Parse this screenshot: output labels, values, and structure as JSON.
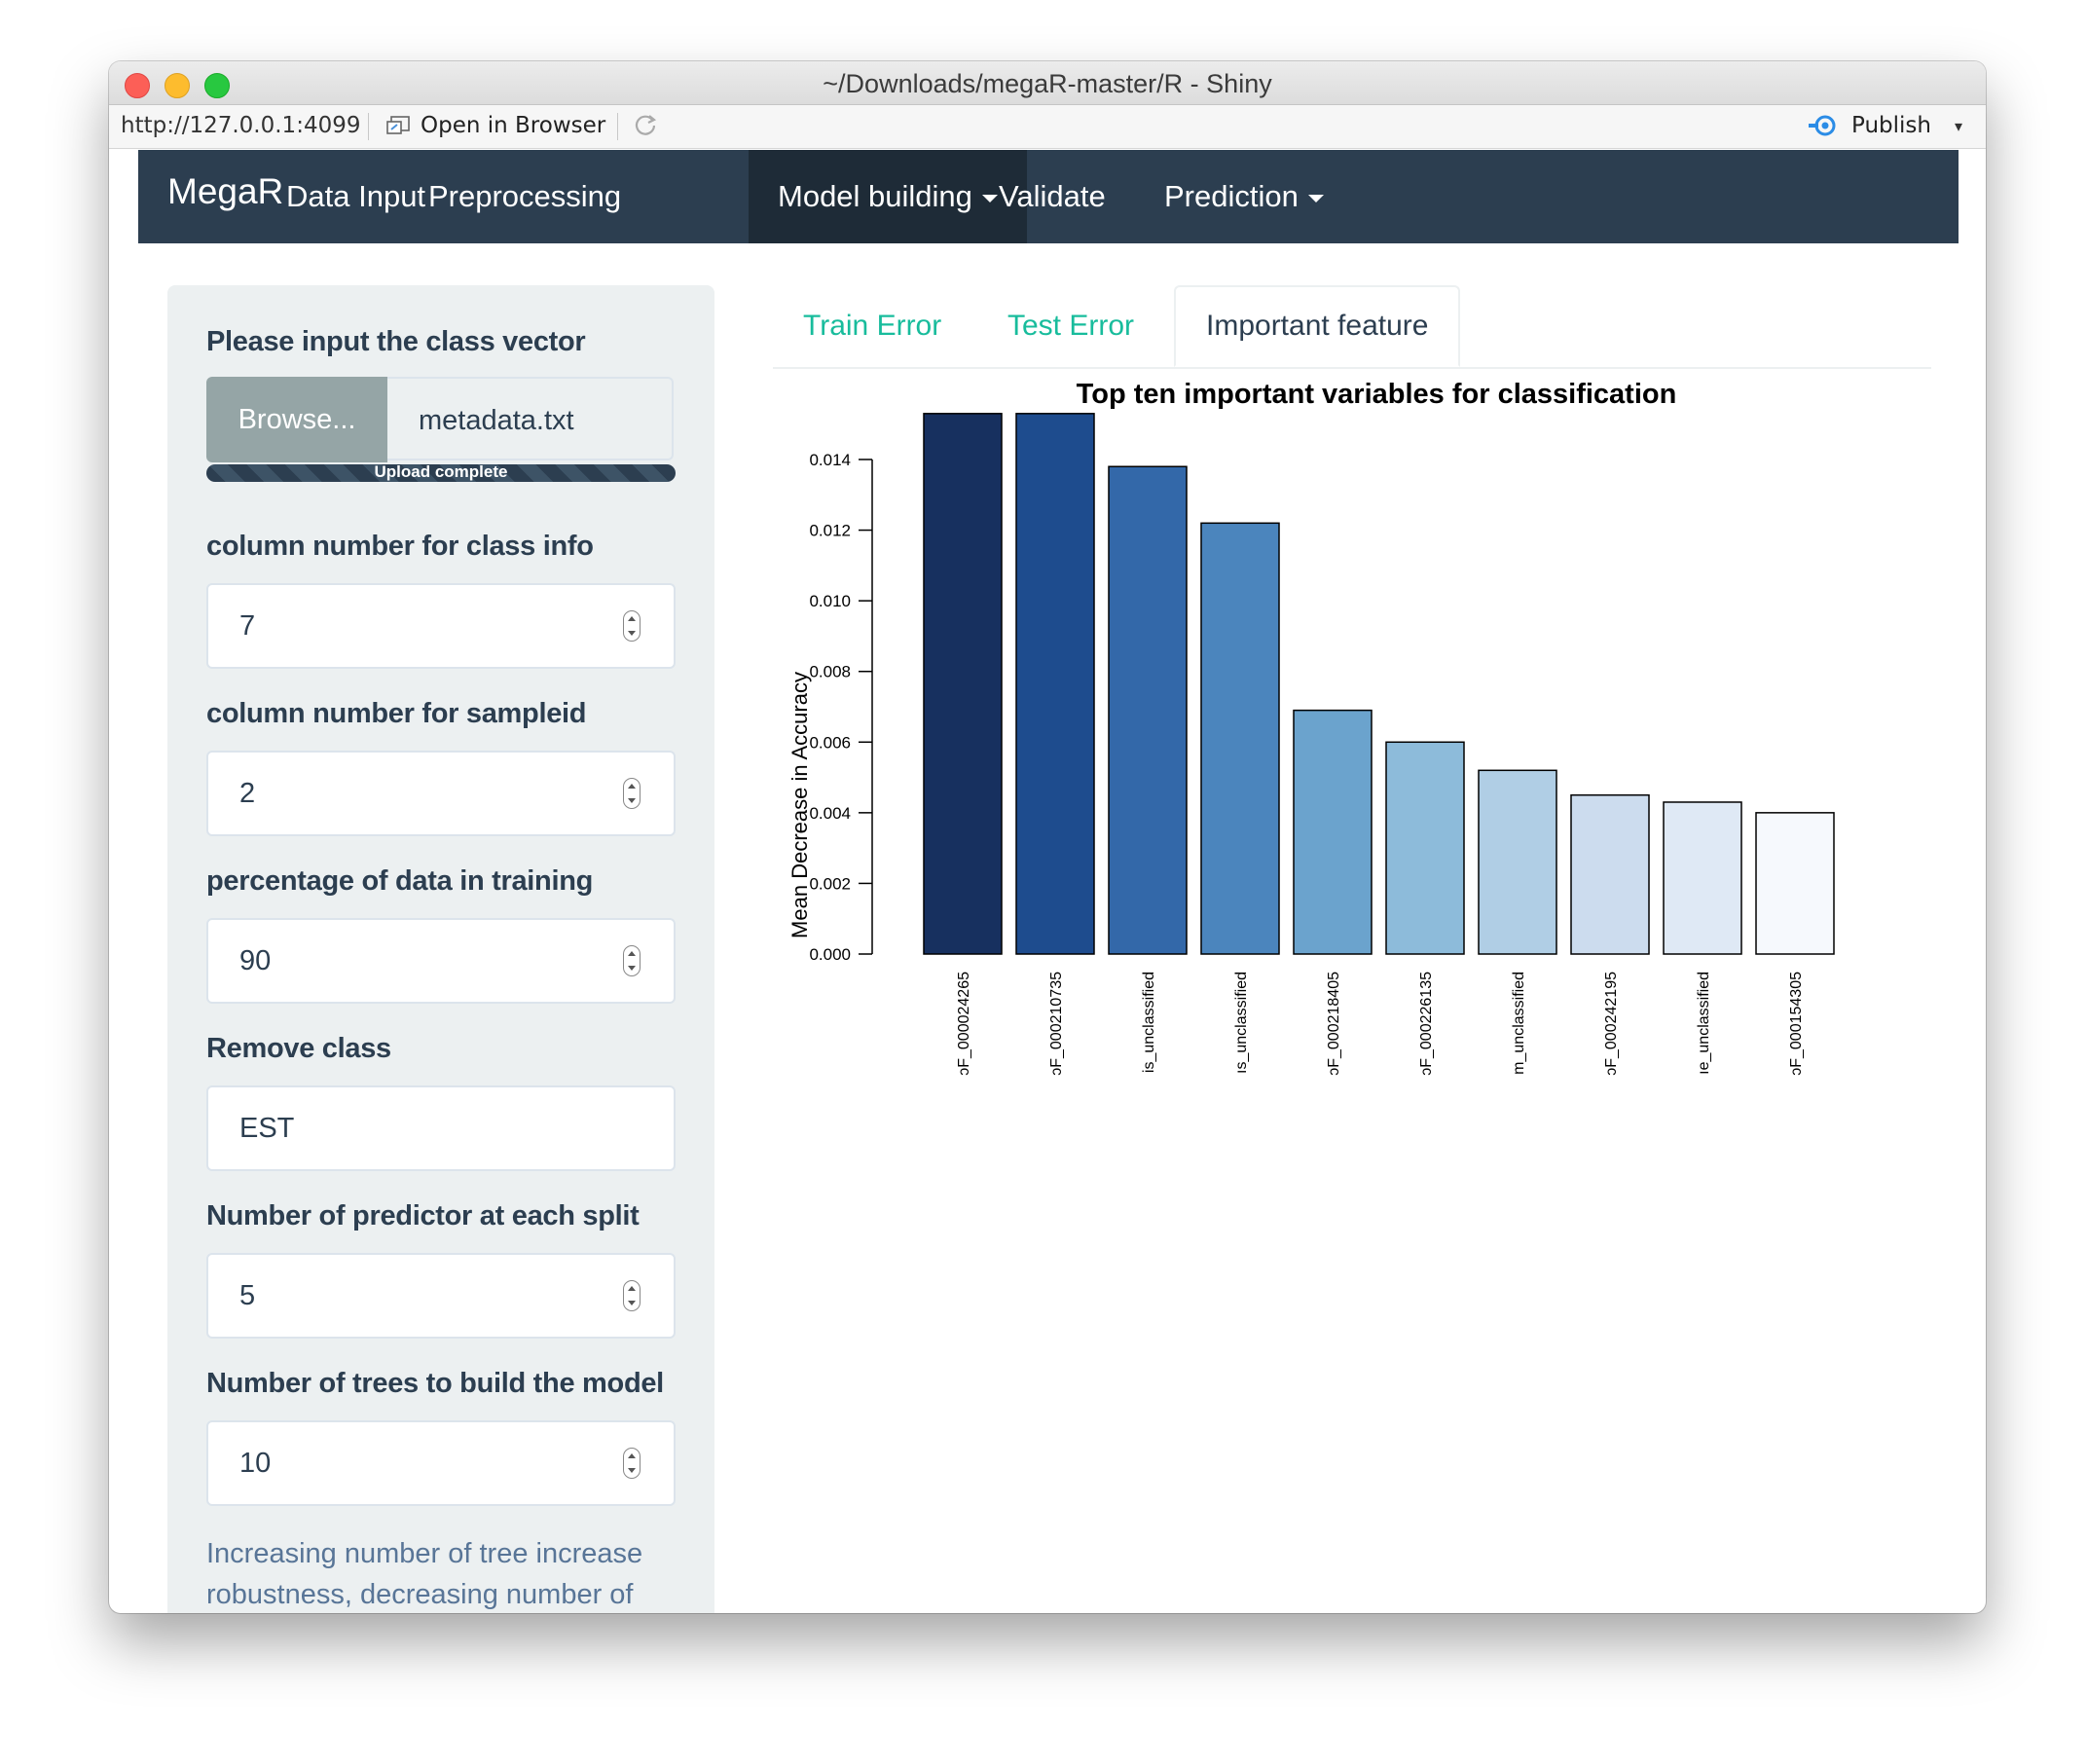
{
  "window": {
    "title": "~/Downloads/megaR-master/R - Shiny",
    "url": "http://127.0.0.1:4099",
    "open_in_browser": "Open in Browser",
    "publish": "Publish"
  },
  "navbar": {
    "brand": "MegaR",
    "items": [
      {
        "label": "Data Input"
      },
      {
        "label": "Preprocessing"
      },
      {
        "label": "Model building",
        "active": true,
        "dropdown": true
      },
      {
        "label": "Validate"
      },
      {
        "label": "Prediction",
        "dropdown": true
      }
    ]
  },
  "sidebar": {
    "class_vector_label": "Please input the class vector",
    "browse_label": "Browse...",
    "file_name": "metadata.txt",
    "upload_status": "Upload complete",
    "upload_progress": 1.0,
    "class_col_label": "column number for class info",
    "class_col_value": "7",
    "sampleid_label": "column number for sampleid",
    "sampleid_value": "2",
    "training_label": "percentage of data in training",
    "training_value": "90",
    "remove_class_label": "Remove class",
    "remove_class_value": "EST",
    "predictor_label": "Number of predictor at each split",
    "predictor_value": "5",
    "trees_label": "Number of trees to build the model",
    "trees_value": "10",
    "help_text": "Increasing number of tree increase robustness, decreasing number of"
  },
  "tabs": [
    {
      "label": "Train Error"
    },
    {
      "label": "Test Error"
    },
    {
      "label": "Important feature",
      "active": true
    }
  ],
  "chart_data": {
    "type": "bar",
    "title": "Top ten important variables for classification",
    "xlabel": "",
    "ylabel": "Mean Decrease in Accuracy",
    "ylim": [
      0,
      0.014
    ],
    "yticks": [
      "0.000",
      "0.002",
      "0.004",
      "0.006",
      "0.008",
      "0.010",
      "0.012",
      "0.014"
    ],
    "grid": false,
    "categories": [
      "ɔF_000024265",
      "ɔF_000210735",
      "is_unclassified",
      "ıs_unclassified",
      "ɔF_000218405",
      "ɔF_000226135",
      "m_unclassified",
      "ɔF_000242195",
      "ıe_unclassified",
      "ɔF_000154305"
    ],
    "values": [
      0.0153,
      0.0153,
      0.0138,
      0.0122,
      0.0069,
      0.006,
      0.0052,
      0.0045,
      0.0043,
      0.004
    ],
    "colors": [
      "#17305f",
      "#1e4c8e",
      "#3368a9",
      "#4b85bd",
      "#6ba3cd",
      "#8dbbda",
      "#b0cee5",
      "#ccdcee",
      "#dfe9f5",
      "#f6f9fd"
    ]
  }
}
